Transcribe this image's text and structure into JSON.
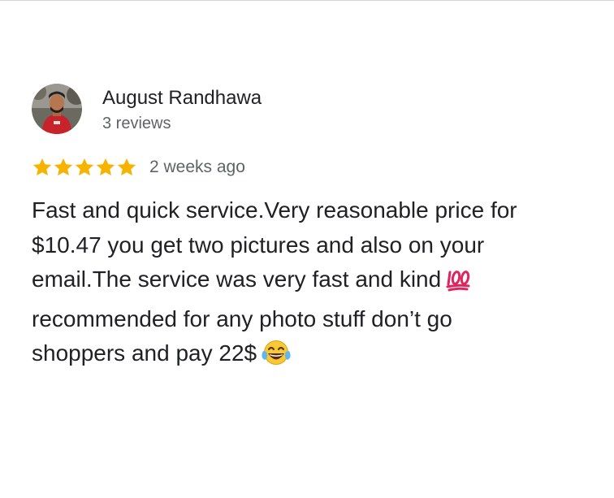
{
  "review": {
    "reviewer_name": "August Randhawa",
    "review_count": "3 reviews",
    "rating": 5,
    "rating_max": 5,
    "date": "2 weeks ago",
    "text_lines": [
      "Fast and quick service.Very reasonable price for",
      "$10.47 you get two pictures and also on your",
      "email.The service was very fast and kind",
      "recommended for any photo stuff don’t go",
      "shoppers and pay 22$"
    ],
    "emojis": [
      "hundred-points-emoji",
      "tears-of-joy-emoji"
    ]
  },
  "colors": {
    "star": "#f6b400",
    "name": "#202124",
    "secondary": "#5f6368",
    "emoji_red": "#e0245e",
    "emoji_yellow": "#f9c934"
  },
  "icons": {
    "avatar": "profile-photo",
    "star": "star-icon"
  }
}
